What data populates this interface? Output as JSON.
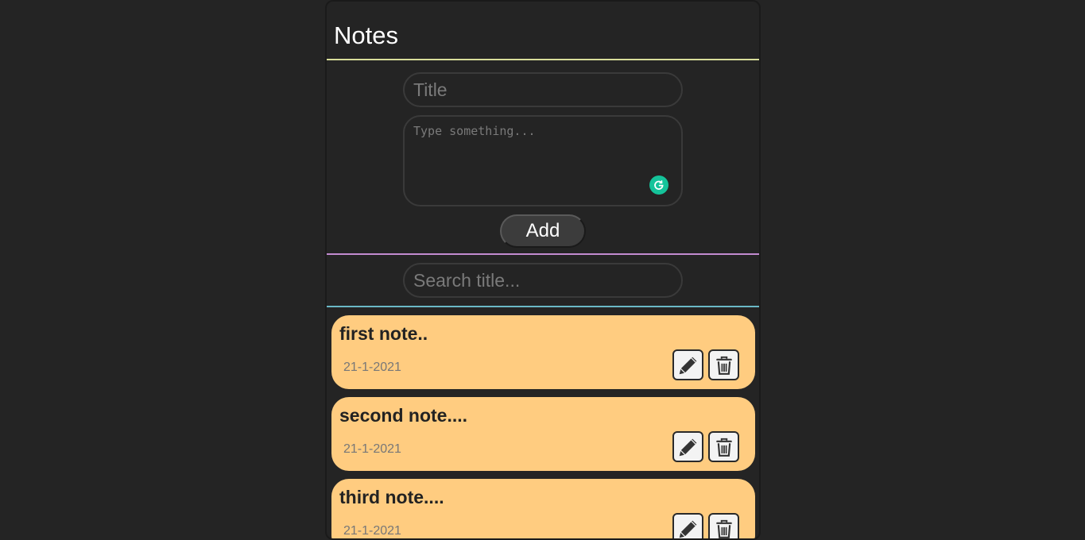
{
  "header": {
    "title": "Notes"
  },
  "form": {
    "title_placeholder": "Title",
    "body_placeholder": "Type something...",
    "add_label": "Add"
  },
  "search": {
    "placeholder": "Search title..."
  },
  "notes": [
    {
      "title": "first note..",
      "date": "21-1-2021"
    },
    {
      "title": "second note....",
      "date": "21-1-2021"
    },
    {
      "title": "third note....",
      "date": "21-1-2021"
    }
  ],
  "colors": {
    "header_divider": "#d8dd9a",
    "form_divider": "#c28bd0",
    "search_divider": "#6ab8c6",
    "note_background": "#ffcc80",
    "grammar_badge": "#15c39a"
  },
  "icons": [
    "grammarly-icon",
    "pencil-icon",
    "trash-icon"
  ]
}
